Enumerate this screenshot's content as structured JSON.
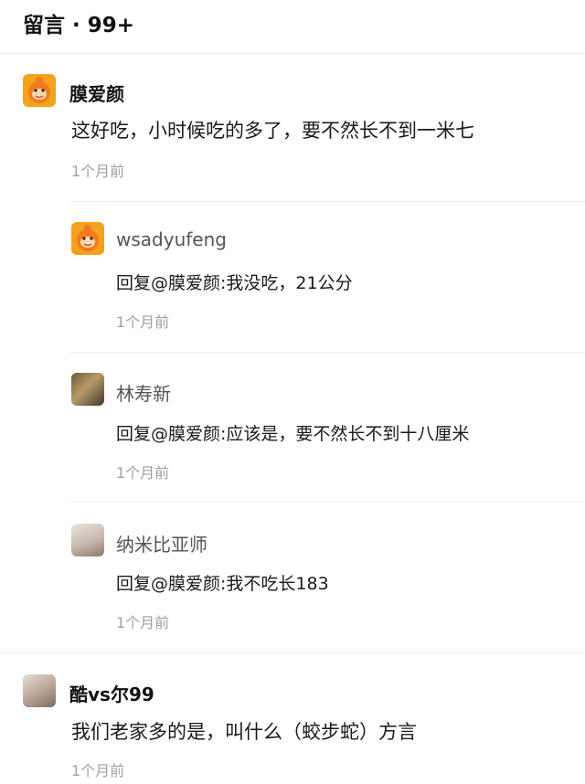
{
  "header": {
    "title": "留言 · 99+"
  },
  "comments": [
    {
      "name": "膜爱颜",
      "avatar": "orange-mascot",
      "content": "这好吃，小时候吃的多了，要不然长不到一米七",
      "time": "1个月前",
      "replies": [
        {
          "name": "wsadyufeng",
          "avatar": "orange-mascot",
          "content": "回复@膜爱颜:我没吃，21公分",
          "time": "1个月前"
        },
        {
          "name": "林寿新",
          "avatar": "photo",
          "content": "回复@膜爱颜:应该是，要不然长不到十八厘米",
          "time": "1个月前"
        },
        {
          "name": "纳米比亚师",
          "avatar": "photo",
          "content": "回复@膜爱颜:我不吃长183",
          "time": "1个月前"
        }
      ]
    },
    {
      "name": "酷vs尔99",
      "avatar": "photo",
      "content": "我们老家多的是，叫什么（蛟步蛇）方言",
      "time": "1个月前",
      "replies": []
    }
  ]
}
